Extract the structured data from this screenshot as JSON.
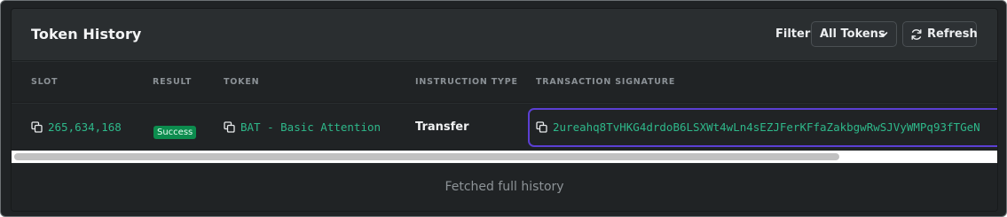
{
  "header": {
    "title": "Token History",
    "filter_label": "Filter:",
    "filter_value": "All Tokens",
    "refresh_label": "Refresh"
  },
  "table": {
    "columns": [
      "SLOT",
      "RESULT",
      "TOKEN",
      "INSTRUCTION TYPE",
      "TRANSACTION SIGNATURE"
    ],
    "rows": [
      {
        "slot": "265,634,168",
        "result": "Success",
        "token": "BAT - Basic Attention",
        "instruction_type": "Transfer",
        "signature": "2ureahq8TvHKG4drdoB6LSXWt4wLn4sEZJFerKFfaZakbgwRwSJVyWMPq93fTGeN"
      }
    ]
  },
  "footer": {
    "status": "Fetched full history"
  },
  "colors": {
    "accent_green": "#2eb88a",
    "success_badge": "#0c8c4e",
    "highlight": "#5b3fd3"
  }
}
